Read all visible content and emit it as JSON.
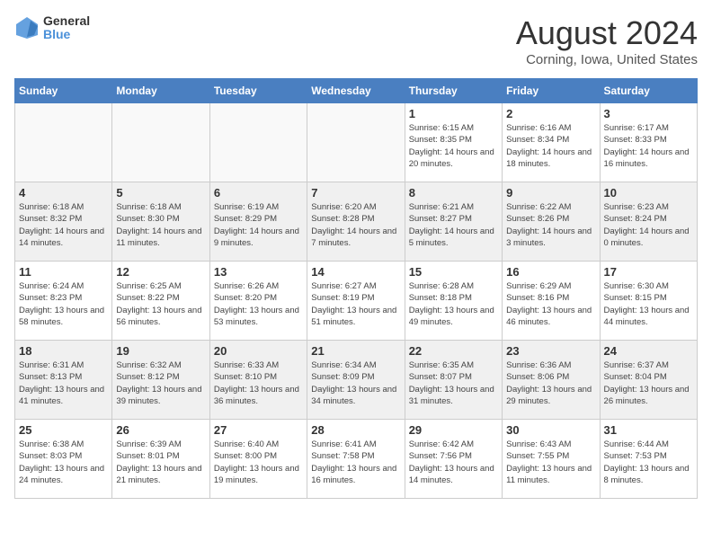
{
  "header": {
    "logo_general": "General",
    "logo_blue": "Blue",
    "title": "August 2024",
    "location": "Corning, Iowa, United States"
  },
  "days_of_week": [
    "Sunday",
    "Monday",
    "Tuesday",
    "Wednesday",
    "Thursday",
    "Friday",
    "Saturday"
  ],
  "weeks": [
    [
      {
        "day": "",
        "info": "",
        "empty": true
      },
      {
        "day": "",
        "info": "",
        "empty": true
      },
      {
        "day": "",
        "info": "",
        "empty": true
      },
      {
        "day": "",
        "info": "",
        "empty": true
      },
      {
        "day": "1",
        "info": "Sunrise: 6:15 AM\nSunset: 8:35 PM\nDaylight: 14 hours and 20 minutes."
      },
      {
        "day": "2",
        "info": "Sunrise: 6:16 AM\nSunset: 8:34 PM\nDaylight: 14 hours and 18 minutes."
      },
      {
        "day": "3",
        "info": "Sunrise: 6:17 AM\nSunset: 8:33 PM\nDaylight: 14 hours and 16 minutes."
      }
    ],
    [
      {
        "day": "4",
        "info": "Sunrise: 6:18 AM\nSunset: 8:32 PM\nDaylight: 14 hours and 14 minutes."
      },
      {
        "day": "5",
        "info": "Sunrise: 6:18 AM\nSunset: 8:30 PM\nDaylight: 14 hours and 11 minutes."
      },
      {
        "day": "6",
        "info": "Sunrise: 6:19 AM\nSunset: 8:29 PM\nDaylight: 14 hours and 9 minutes."
      },
      {
        "day": "7",
        "info": "Sunrise: 6:20 AM\nSunset: 8:28 PM\nDaylight: 14 hours and 7 minutes."
      },
      {
        "day": "8",
        "info": "Sunrise: 6:21 AM\nSunset: 8:27 PM\nDaylight: 14 hours and 5 minutes."
      },
      {
        "day": "9",
        "info": "Sunrise: 6:22 AM\nSunset: 8:26 PM\nDaylight: 14 hours and 3 minutes."
      },
      {
        "day": "10",
        "info": "Sunrise: 6:23 AM\nSunset: 8:24 PM\nDaylight: 14 hours and 0 minutes."
      }
    ],
    [
      {
        "day": "11",
        "info": "Sunrise: 6:24 AM\nSunset: 8:23 PM\nDaylight: 13 hours and 58 minutes."
      },
      {
        "day": "12",
        "info": "Sunrise: 6:25 AM\nSunset: 8:22 PM\nDaylight: 13 hours and 56 minutes."
      },
      {
        "day": "13",
        "info": "Sunrise: 6:26 AM\nSunset: 8:20 PM\nDaylight: 13 hours and 53 minutes."
      },
      {
        "day": "14",
        "info": "Sunrise: 6:27 AM\nSunset: 8:19 PM\nDaylight: 13 hours and 51 minutes."
      },
      {
        "day": "15",
        "info": "Sunrise: 6:28 AM\nSunset: 8:18 PM\nDaylight: 13 hours and 49 minutes."
      },
      {
        "day": "16",
        "info": "Sunrise: 6:29 AM\nSunset: 8:16 PM\nDaylight: 13 hours and 46 minutes."
      },
      {
        "day": "17",
        "info": "Sunrise: 6:30 AM\nSunset: 8:15 PM\nDaylight: 13 hours and 44 minutes."
      }
    ],
    [
      {
        "day": "18",
        "info": "Sunrise: 6:31 AM\nSunset: 8:13 PM\nDaylight: 13 hours and 41 minutes."
      },
      {
        "day": "19",
        "info": "Sunrise: 6:32 AM\nSunset: 8:12 PM\nDaylight: 13 hours and 39 minutes."
      },
      {
        "day": "20",
        "info": "Sunrise: 6:33 AM\nSunset: 8:10 PM\nDaylight: 13 hours and 36 minutes."
      },
      {
        "day": "21",
        "info": "Sunrise: 6:34 AM\nSunset: 8:09 PM\nDaylight: 13 hours and 34 minutes."
      },
      {
        "day": "22",
        "info": "Sunrise: 6:35 AM\nSunset: 8:07 PM\nDaylight: 13 hours and 31 minutes."
      },
      {
        "day": "23",
        "info": "Sunrise: 6:36 AM\nSunset: 8:06 PM\nDaylight: 13 hours and 29 minutes."
      },
      {
        "day": "24",
        "info": "Sunrise: 6:37 AM\nSunset: 8:04 PM\nDaylight: 13 hours and 26 minutes."
      }
    ],
    [
      {
        "day": "25",
        "info": "Sunrise: 6:38 AM\nSunset: 8:03 PM\nDaylight: 13 hours and 24 minutes."
      },
      {
        "day": "26",
        "info": "Sunrise: 6:39 AM\nSunset: 8:01 PM\nDaylight: 13 hours and 21 minutes."
      },
      {
        "day": "27",
        "info": "Sunrise: 6:40 AM\nSunset: 8:00 PM\nDaylight: 13 hours and 19 minutes."
      },
      {
        "day": "28",
        "info": "Sunrise: 6:41 AM\nSunset: 7:58 PM\nDaylight: 13 hours and 16 minutes."
      },
      {
        "day": "29",
        "info": "Sunrise: 6:42 AM\nSunset: 7:56 PM\nDaylight: 13 hours and 14 minutes."
      },
      {
        "day": "30",
        "info": "Sunrise: 6:43 AM\nSunset: 7:55 PM\nDaylight: 13 hours and 11 minutes."
      },
      {
        "day": "31",
        "info": "Sunrise: 6:44 AM\nSunset: 7:53 PM\nDaylight: 13 hours and 8 minutes."
      }
    ]
  ]
}
